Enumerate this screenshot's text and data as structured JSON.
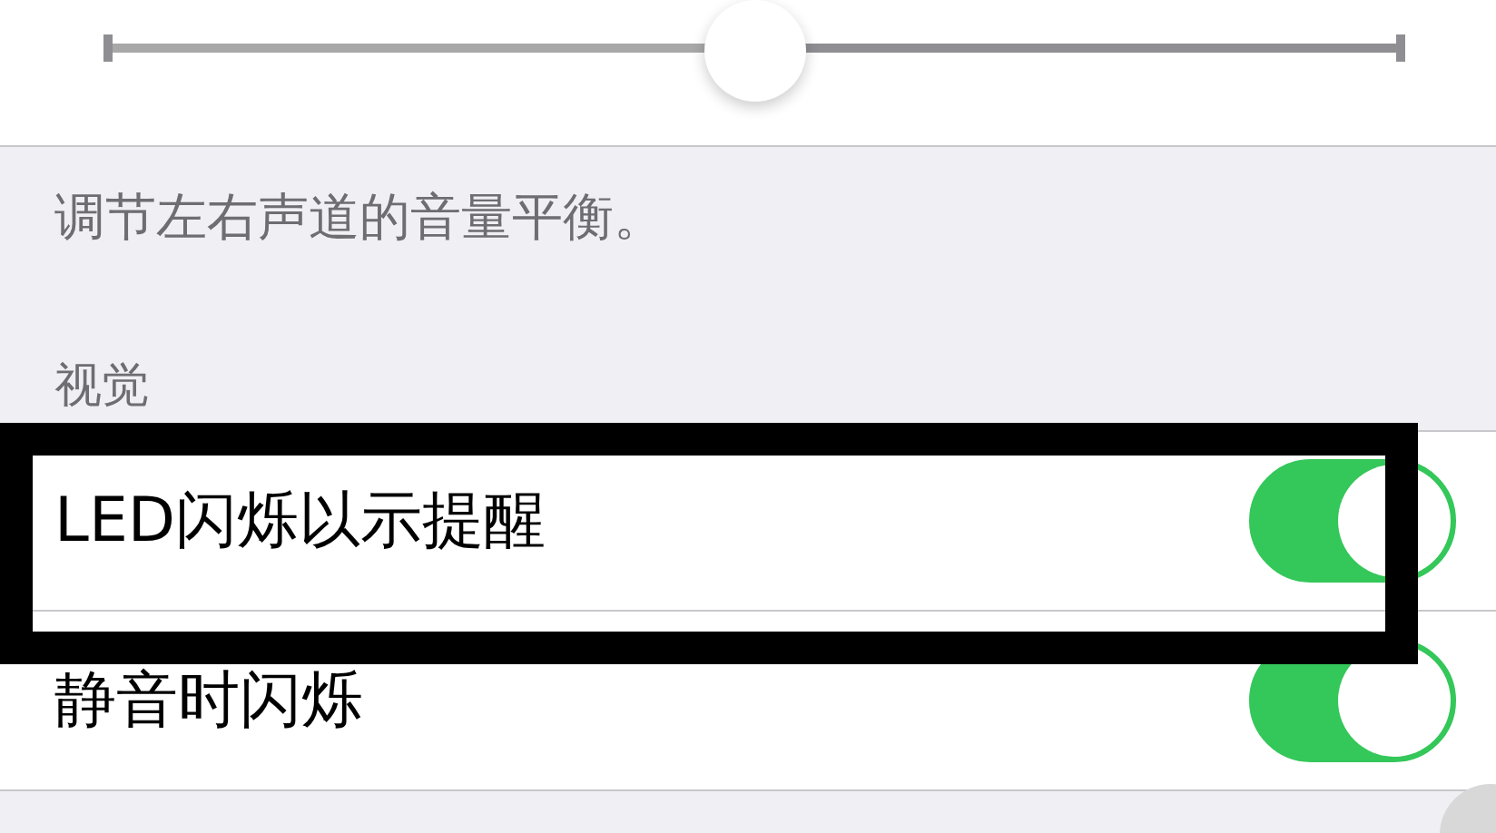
{
  "balance_slider": {
    "level": 0.5
  },
  "footer": "调节左右声道的音量平衡。",
  "section_header": "视觉",
  "rows": [
    {
      "label": "LED闪烁以示提醒",
      "on": true
    },
    {
      "label": "静音时闪烁",
      "on": true
    }
  ],
  "highlight_frame": {
    "shown": true
  }
}
